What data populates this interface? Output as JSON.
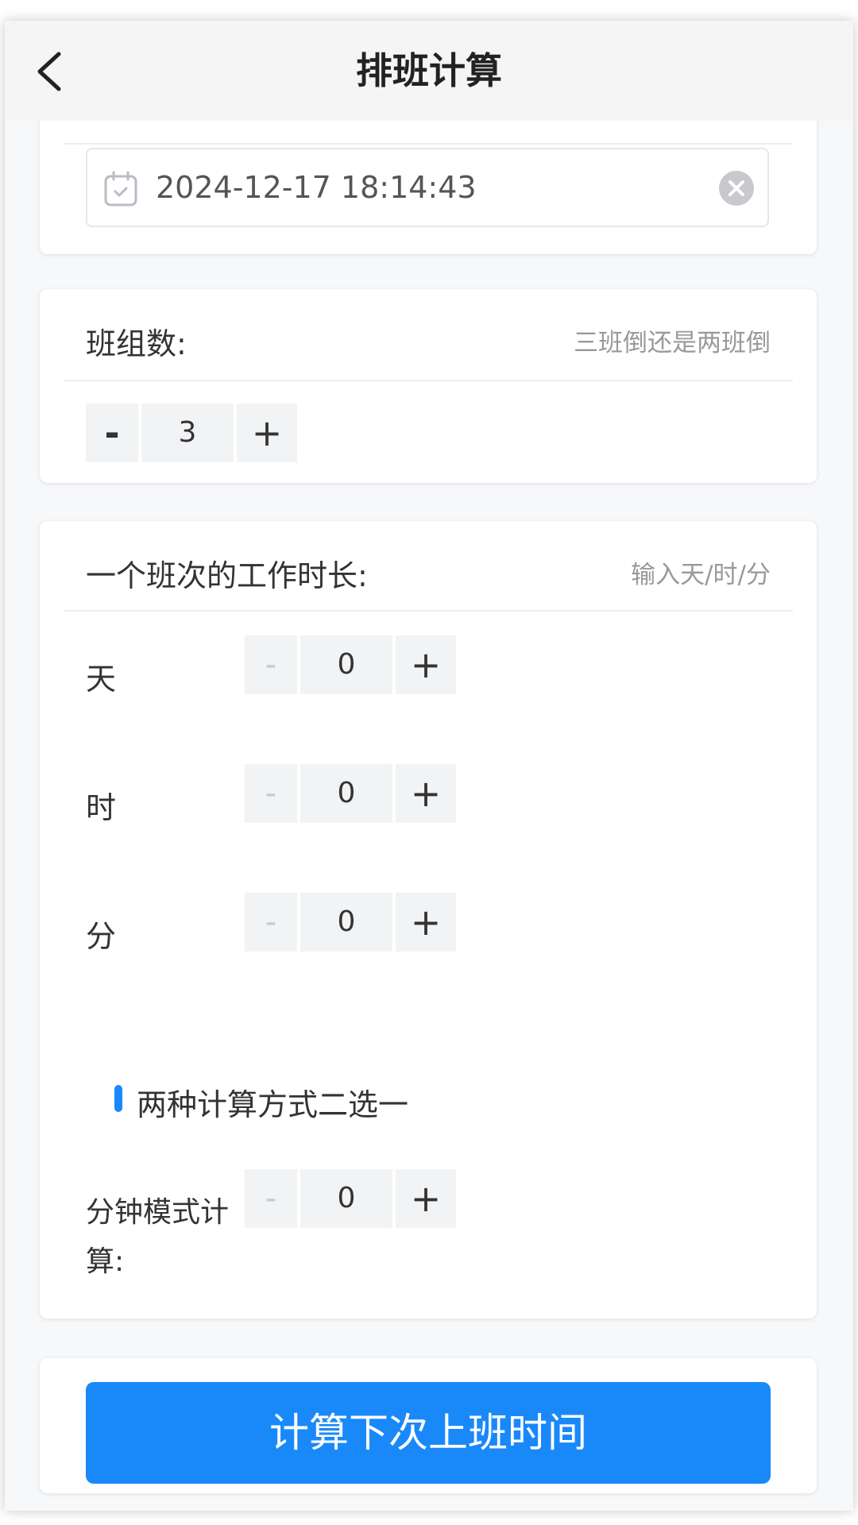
{
  "header": {
    "title": "排班计算"
  },
  "date_picker": {
    "value": "2024-12-17 18:14:43"
  },
  "group_count": {
    "label": "班组数:",
    "hint": "三班倒还是两班倒",
    "minus": "-",
    "value": "3",
    "plus": "+"
  },
  "duration": {
    "label": "一个班次的工作时长:",
    "hint": "输入天/时/分",
    "rows": [
      {
        "label": "天",
        "minus": "-",
        "value": "0",
        "plus": "+"
      },
      {
        "label": "时",
        "minus": "-",
        "value": "0",
        "plus": "+"
      },
      {
        "label": "分",
        "minus": "-",
        "value": "0",
        "plus": "+"
      }
    ],
    "section_title": "两种计算方式二选一",
    "minute_mode": {
      "label": "分钟模式计算:",
      "minus": "-",
      "value": "0",
      "plus": "+"
    }
  },
  "action": {
    "submit_label": "计算下次上班时间"
  },
  "colors": {
    "accent": "#1989fa",
    "background": "#f7f8fa",
    "navbar": "#f5f5f5"
  }
}
